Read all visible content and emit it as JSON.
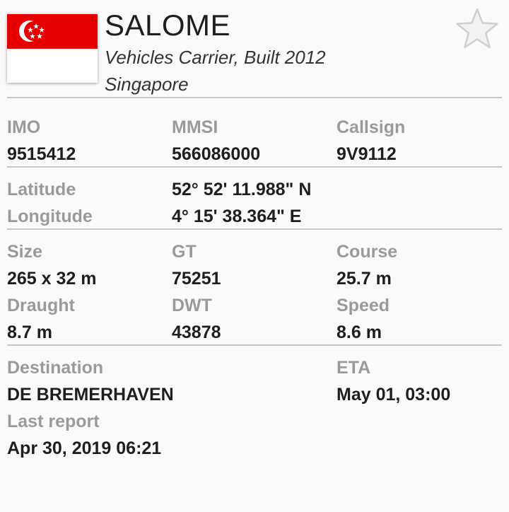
{
  "vessel": {
    "name": "SALOME",
    "type_line": "Vehicles Carrier, Built 2012",
    "flag_country": "Singapore",
    "flag_colors": {
      "red": "#e60000",
      "white": "#ffffff"
    }
  },
  "favorite": {
    "icon": "star-outline-icon",
    "color": "#d9d9d9"
  },
  "ids": {
    "imo_label": "IMO",
    "imo_value": "9515412",
    "mmsi_label": "MMSI",
    "mmsi_value": "566086000",
    "callsign_label": "Callsign",
    "callsign_value": "9V9112"
  },
  "position": {
    "lat_label": "Latitude",
    "lat_value": "52° 52' 11.988\" N",
    "lon_label": "Longitude",
    "lon_value": "4° 15' 38.364\" E"
  },
  "dimensions": {
    "size_label": "Size",
    "size_value": "265 x 32 m",
    "gt_label": "GT",
    "gt_value": "75251",
    "course_label": "Course",
    "course_value": "25.7 m",
    "draught_label": "Draught",
    "draught_value": "8.7 m",
    "dwt_label": "DWT",
    "dwt_value": "43878",
    "speed_label": "Speed",
    "speed_value": "8.6 m"
  },
  "voyage": {
    "destination_label": "Destination",
    "destination_value": "DE BREMERHAVEN",
    "eta_label": "ETA",
    "eta_value": "May 01, 03:00",
    "last_report_label": "Last report",
    "last_report_value": "Apr 30, 2019 06:21"
  }
}
